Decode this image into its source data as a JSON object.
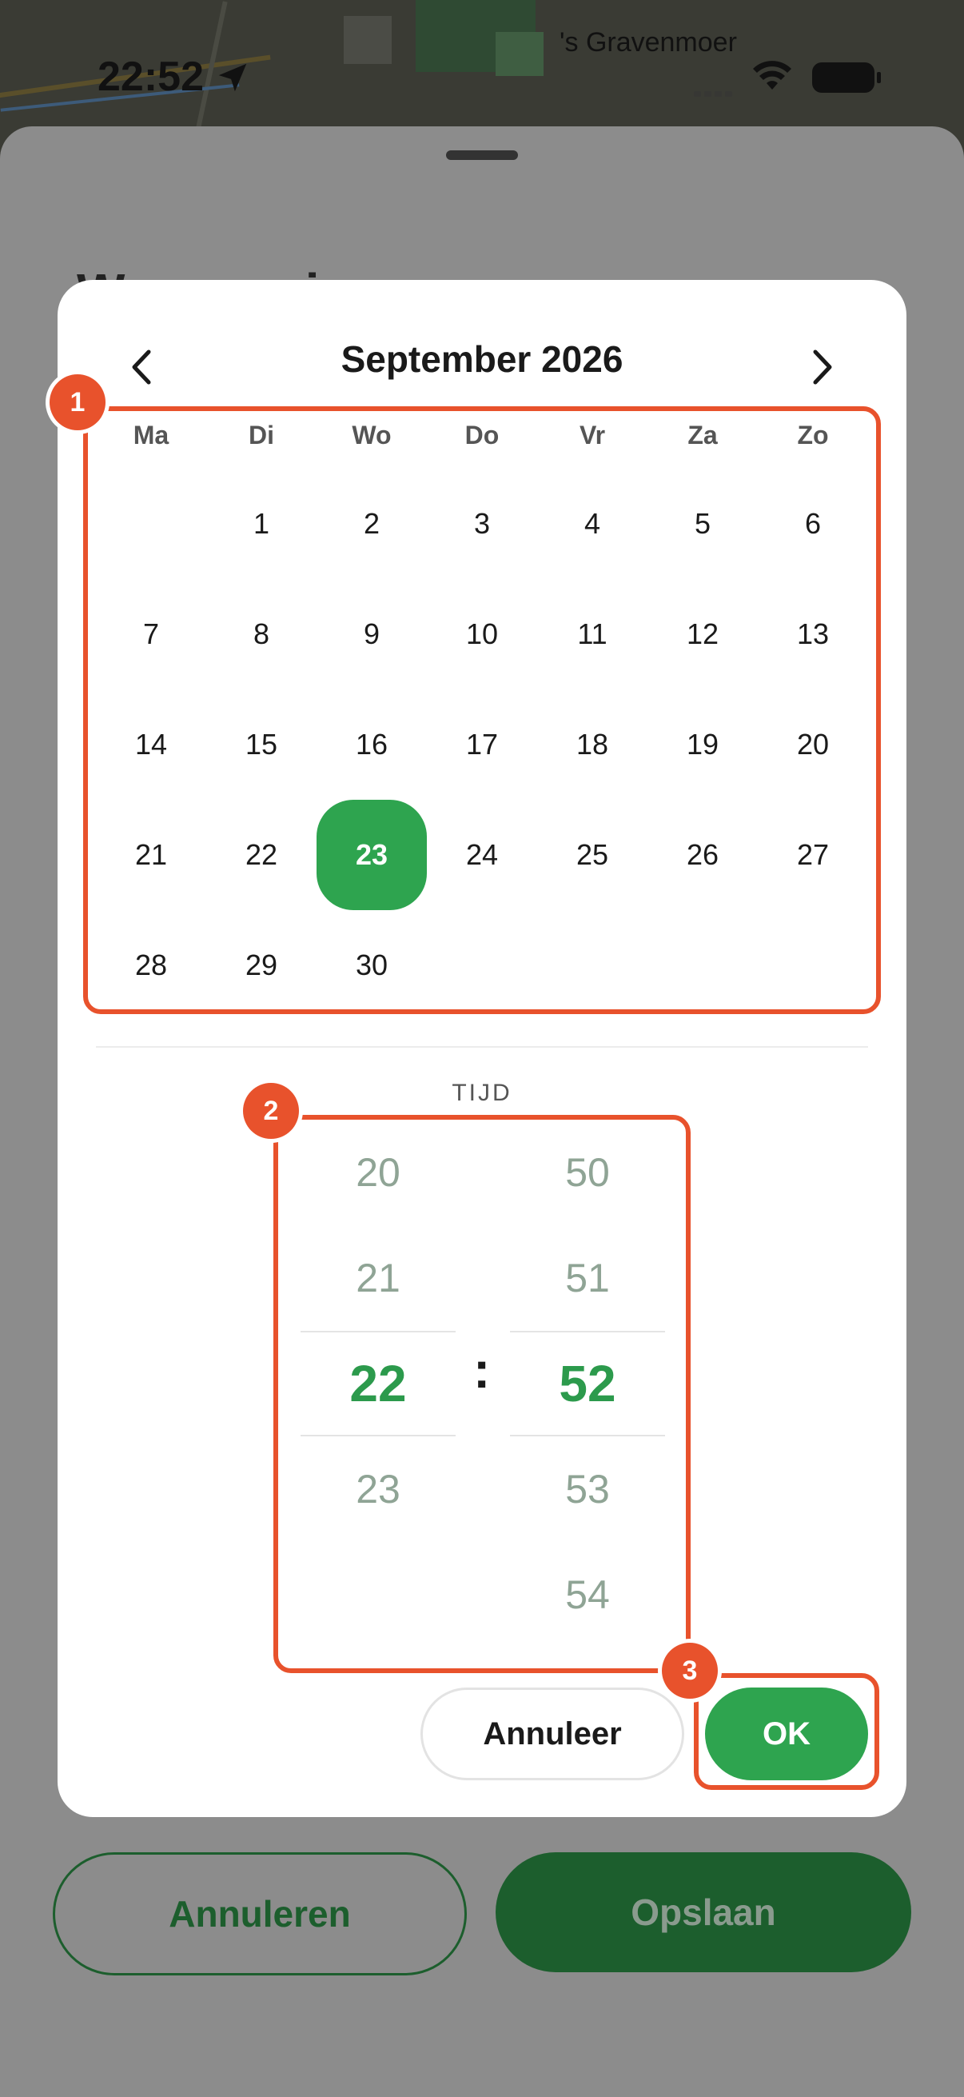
{
  "status_bar": {
    "time": "22:52",
    "place": "'s Gravenmoer"
  },
  "sheet": {
    "title": "Wanneer is",
    "cancel_label": "Annuleren",
    "save_label": "Opslaan"
  },
  "calendar": {
    "month_title": "September 2026",
    "weekdays": [
      "Ma",
      "Di",
      "Wo",
      "Do",
      "Vr",
      "Za",
      "Zo"
    ],
    "days": [
      "",
      "1",
      "2",
      "3",
      "4",
      "5",
      "6",
      "7",
      "8",
      "9",
      "10",
      "11",
      "12",
      "13",
      "14",
      "15",
      "16",
      "17",
      "18",
      "19",
      "20",
      "21",
      "22",
      "23",
      "24",
      "25",
      "26",
      "27",
      "28",
      "29",
      "30"
    ],
    "selected_day": "23"
  },
  "time_picker": {
    "label": "TIJD",
    "hours": [
      "20",
      "21",
      "22",
      "23",
      ""
    ],
    "minutes": [
      "50",
      "51",
      "52",
      "53",
      "54"
    ],
    "selected_hour": "22",
    "selected_minute": "52",
    "separator": ":"
  },
  "dialog_buttons": {
    "cancel_label": "Annuleer",
    "ok_label": "OK"
  },
  "annotations": {
    "badge1": "1",
    "badge2": "2",
    "badge3": "3",
    "color": "#e8522c"
  },
  "colors": {
    "accent_green": "#2ea44f",
    "dark_green": "#1c5e2d"
  },
  "icons": {
    "prev": "chevron-left-icon",
    "next": "chevron-right-icon",
    "location": "location-arrow-icon",
    "wifi": "wifi-icon",
    "battery": "battery-icon"
  }
}
